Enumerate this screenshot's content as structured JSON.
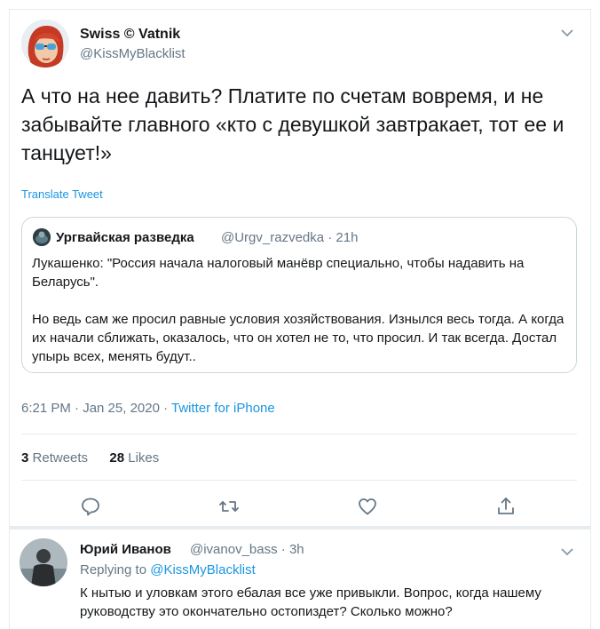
{
  "tweet": {
    "author_name": "Swiss © Vatnik",
    "author_handle": "@KissMyBlacklist",
    "text": "А что на нее давить? Платите по счетам вовремя, и не забывайте главного «кто с девушкой завтракает, тот ее и танцует!»",
    "translate_label": "Translate Tweet",
    "time": "6:21 PM · Jan 25, 2020 · ",
    "source": "Twitter for iPhone",
    "retweets_count": "3",
    "retweets_label": "Retweets",
    "likes_count": "28",
    "likes_label": "Likes"
  },
  "quoted": {
    "author_name": "Ургвайская разведка",
    "meta": "@Urgv_razvedka · 21h",
    "paragraph1": "Лукашенко: \"Россия начала налоговый манёвр специально, чтобы надавить на Беларусь\".",
    "paragraph2": "Но ведь сам же просил равные условия хозяйствования. Изнылся весь тогда. А когда их начали сближать, оказалось, что он хотел не то, что просил. И так всегда. Достал упырь всех, менять будут.."
  },
  "actions": [
    {
      "icon": "reply-icon"
    },
    {
      "icon": "retweet-icon"
    },
    {
      "icon": "like-icon"
    },
    {
      "icon": "share-icon"
    }
  ],
  "reply": {
    "author_name": "Юрий Иванов",
    "meta": "@ivanov_bass · 3h",
    "replying_prefix": "Replying to ",
    "replying_to": "@KissMyBlacklist",
    "text": "К нытью и уловкам этого ебалая все уже привыкли. Вопрос, когда нашему руководству это окончательно остопиздет? Сколько можно?"
  },
  "colors": {
    "link_blue": "#1b95e0",
    "secondary_text": "#657786",
    "border": "#e6ecf0"
  }
}
